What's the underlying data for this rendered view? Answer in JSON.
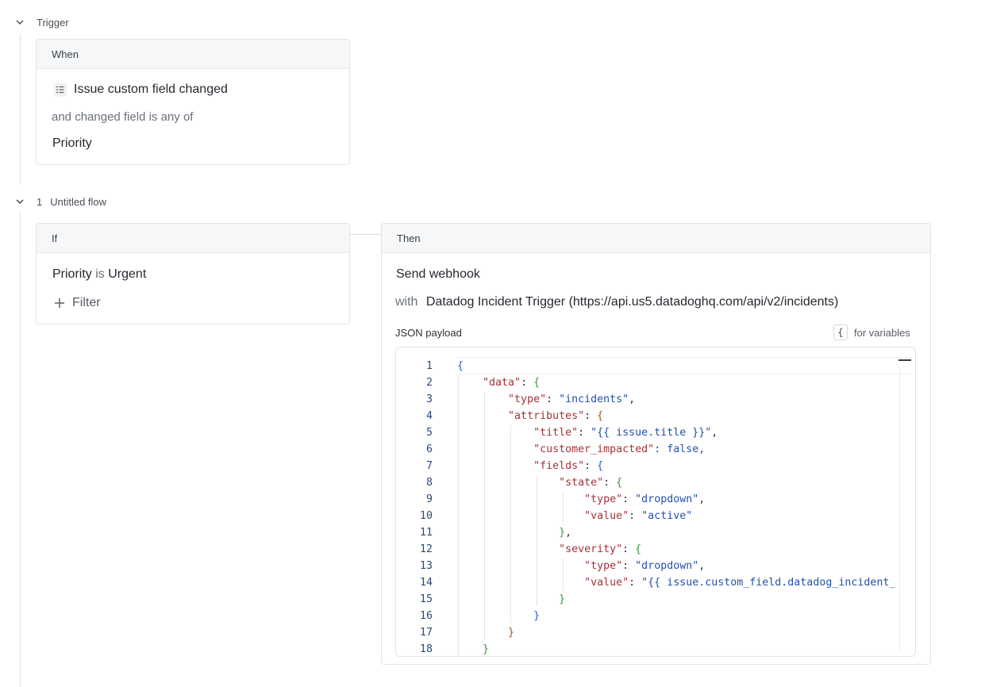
{
  "trigger": {
    "section_label": "Trigger",
    "card_header": "When",
    "event_label": "Issue custom field changed",
    "condition_label": "and changed field is any of",
    "condition_value": "Priority"
  },
  "flow": {
    "number": "1",
    "name": "Untitled flow",
    "if_card": {
      "header": "If",
      "filter_field": "Priority",
      "filter_operator": "is",
      "filter_value": "Urgent",
      "add_filter_label": "Filter"
    },
    "then_card": {
      "header": "Then",
      "action_label": "Send webhook",
      "with_label": "with",
      "webhook_target": "Datadog Incident Trigger (https://api.us5.datadoghq.com/api/v2/incidents)",
      "payload_label": "JSON payload",
      "variables_key": "{",
      "variables_hint": "for variables"
    }
  },
  "editor": {
    "lines": [
      {
        "n": "1",
        "code": "{"
      },
      {
        "n": "2",
        "code": "    \"data\": {"
      },
      {
        "n": "3",
        "code": "        \"type\": \"incidents\","
      },
      {
        "n": "4",
        "code": "        \"attributes\": {"
      },
      {
        "n": "5",
        "code": "            \"title\": \"{{ issue.title }}\","
      },
      {
        "n": "6",
        "code": "            \"customer_impacted\": false,"
      },
      {
        "n": "7",
        "code": "            \"fields\": {"
      },
      {
        "n": "8",
        "code": "                \"state\": {"
      },
      {
        "n": "9",
        "code": "                    \"type\": \"dropdown\","
      },
      {
        "n": "10",
        "code": "                    \"value\": \"active\""
      },
      {
        "n": "11",
        "code": "                },"
      },
      {
        "n": "12",
        "code": "                \"severity\": {"
      },
      {
        "n": "13",
        "code": "                    \"type\": \"dropdown\","
      },
      {
        "n": "14",
        "code": "                    \"value\": \"{{ issue.custom_field.datadog_incident_"
      },
      {
        "n": "15",
        "code": "                }"
      },
      {
        "n": "16",
        "code": "            }"
      },
      {
        "n": "17",
        "code": "        }"
      },
      {
        "n": "18",
        "code": "    }"
      }
    ]
  },
  "colors": {
    "key": "#a3333a",
    "string": "#2451a8",
    "brace_depth_1": "#2f5cd6",
    "brace_depth_2": "#3b9a3a",
    "brace_depth_3": "#b34a26",
    "line_number": "#2c4a75"
  }
}
